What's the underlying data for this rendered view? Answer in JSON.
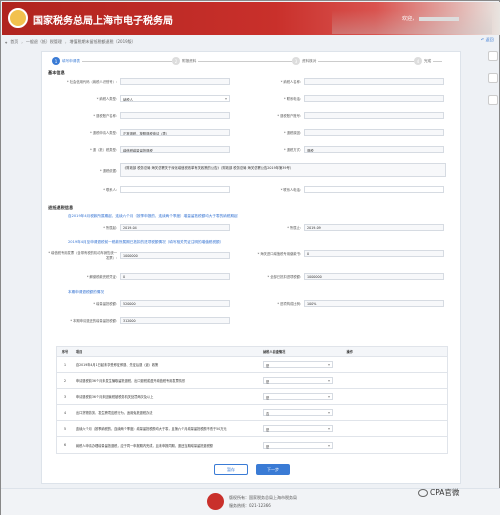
{
  "header": {
    "site_title": "国家税务总局上海市电子税务局",
    "welcome": "欢迎，"
  },
  "breadcrumb": [
    "首页",
    "一般退（抵）税管理",
    "增值税期末留抵税额退税（2019版）"
  ],
  "back_label": "返回",
  "steps": [
    {
      "num": "1",
      "label": "填写申请表"
    },
    {
      "num": "2",
      "label": "附报资料"
    },
    {
      "num": "3",
      "label": "资料核对"
    },
    {
      "num": "4",
      "label": "完成"
    }
  ],
  "basic_info": {
    "title": "基本信息",
    "taxpayer_id_label": "* 社会信用代码（纳税人识别号）:",
    "taxpayer_name_label": "* 纳税人名称:",
    "applicant_type_label": "* 纳税人类型:",
    "applicant_type_value": "纳税人",
    "contact_label": "* 联系电话:",
    "bank_label": "* 退税账户名称:",
    "account_label": "* 退税账户账号:",
    "dept_label": "* 退税申请人类型:",
    "dept_value": "正常退税，按照退税申请（表）",
    "refund_reason_label": "* 退税原因:",
    "refund_type_label": "* 退（抵）税类型:",
    "refund_type_value": "增值税增量留抵退税",
    "refund_method_label": "* 退税方式:",
    "refund_method_value": "退税",
    "policy_label": "* 退税依据:",
    "policy_value": "《财政部 税务总局 海关总署关于深化增值税改革有关政策的公告》（财政部 税务总局 海关总署公告2019年第39号）",
    "contact_person_label": "* 联系人:",
    "contact_person_phone_label": "* 联系人电话:"
  },
  "rebate_info": {
    "title": "退抵退税信息",
    "note_1": "自2019年4月税款所属期起，连续六个月（按季申报的，连续两个季度）增量留抵税额均大于零的纳税期起",
    "start_label": "* 所属起:",
    "start_value": "2019-04",
    "end_label": "* 所属止:",
    "end_value": "2019-09",
    "note_2": "2019年4月至申请退税前一税款所属期已抵扣的进项税额情况（填写相关凭证注明的增值税税额）",
    "vat_invoice_label": "* 增值税专用发票（含带有税的机动车销售统一发票）:",
    "vat_invoice_value": "1000000",
    "customs_label": "* 海关进口增值税专用缴款书:",
    "customs_value": "0",
    "agricultural_label": "* 解缴税款完税凭证:",
    "agricultural_value": "0",
    "total_label": "* 全部已抵扣进项税额:",
    "total_value": "1000000",
    "note_3": "本期申请退税额的情况",
    "increment_label": "* 增量留抵税额:",
    "increment_value": "520000",
    "ratio_label": "* 进项构成比例:",
    "ratio_value": "100%",
    "apply_label": "* 本期申请退还的增量留抵税额:",
    "apply_value": "312000"
  },
  "table": {
    "headers": [
      "序号",
      "项目",
      "纳税人自查情况",
      "操作"
    ],
    "rows": [
      {
        "no": "1",
        "item": "自2019年4月1日起未享受即征即退、先征后退（返）政策",
        "value": "是"
      },
      {
        "no": "2",
        "item": "申请退税前36个月未发生骗取留抵退税、出口退税或虚开增值税专用发票情形",
        "value": "是"
      },
      {
        "no": "3",
        "item": "申请退税前36个月未因偷税被税务机关处罚两次及以上",
        "value": "是"
      },
      {
        "no": "4",
        "item": "出口货物劳务、发生跨境应税行为，适用免抵退税办法",
        "value": "否"
      },
      {
        "no": "5",
        "item": "连续六个月（按季纳税的，连续两个季度）增量留抵税额均大于零，且第六个月增量留抵税额不低于50万元",
        "value": "是"
      },
      {
        "no": "6",
        "item": "纳税人申请办理增量留抵退税，应于同一申报期内完成，且未申报同期，退还当期增量留抵退税额",
        "value": "是"
      }
    ]
  },
  "buttons": {
    "save": "暂存",
    "next": "下一步"
  },
  "footer": {
    "line1": "版权所有：国家税务总局上海市税务局",
    "line2": "服务热线：021-12366"
  },
  "watermark": "CPA官微",
  "colors": {
    "brand_red": "#c9302b",
    "accent_blue": "#3a7bd5"
  }
}
